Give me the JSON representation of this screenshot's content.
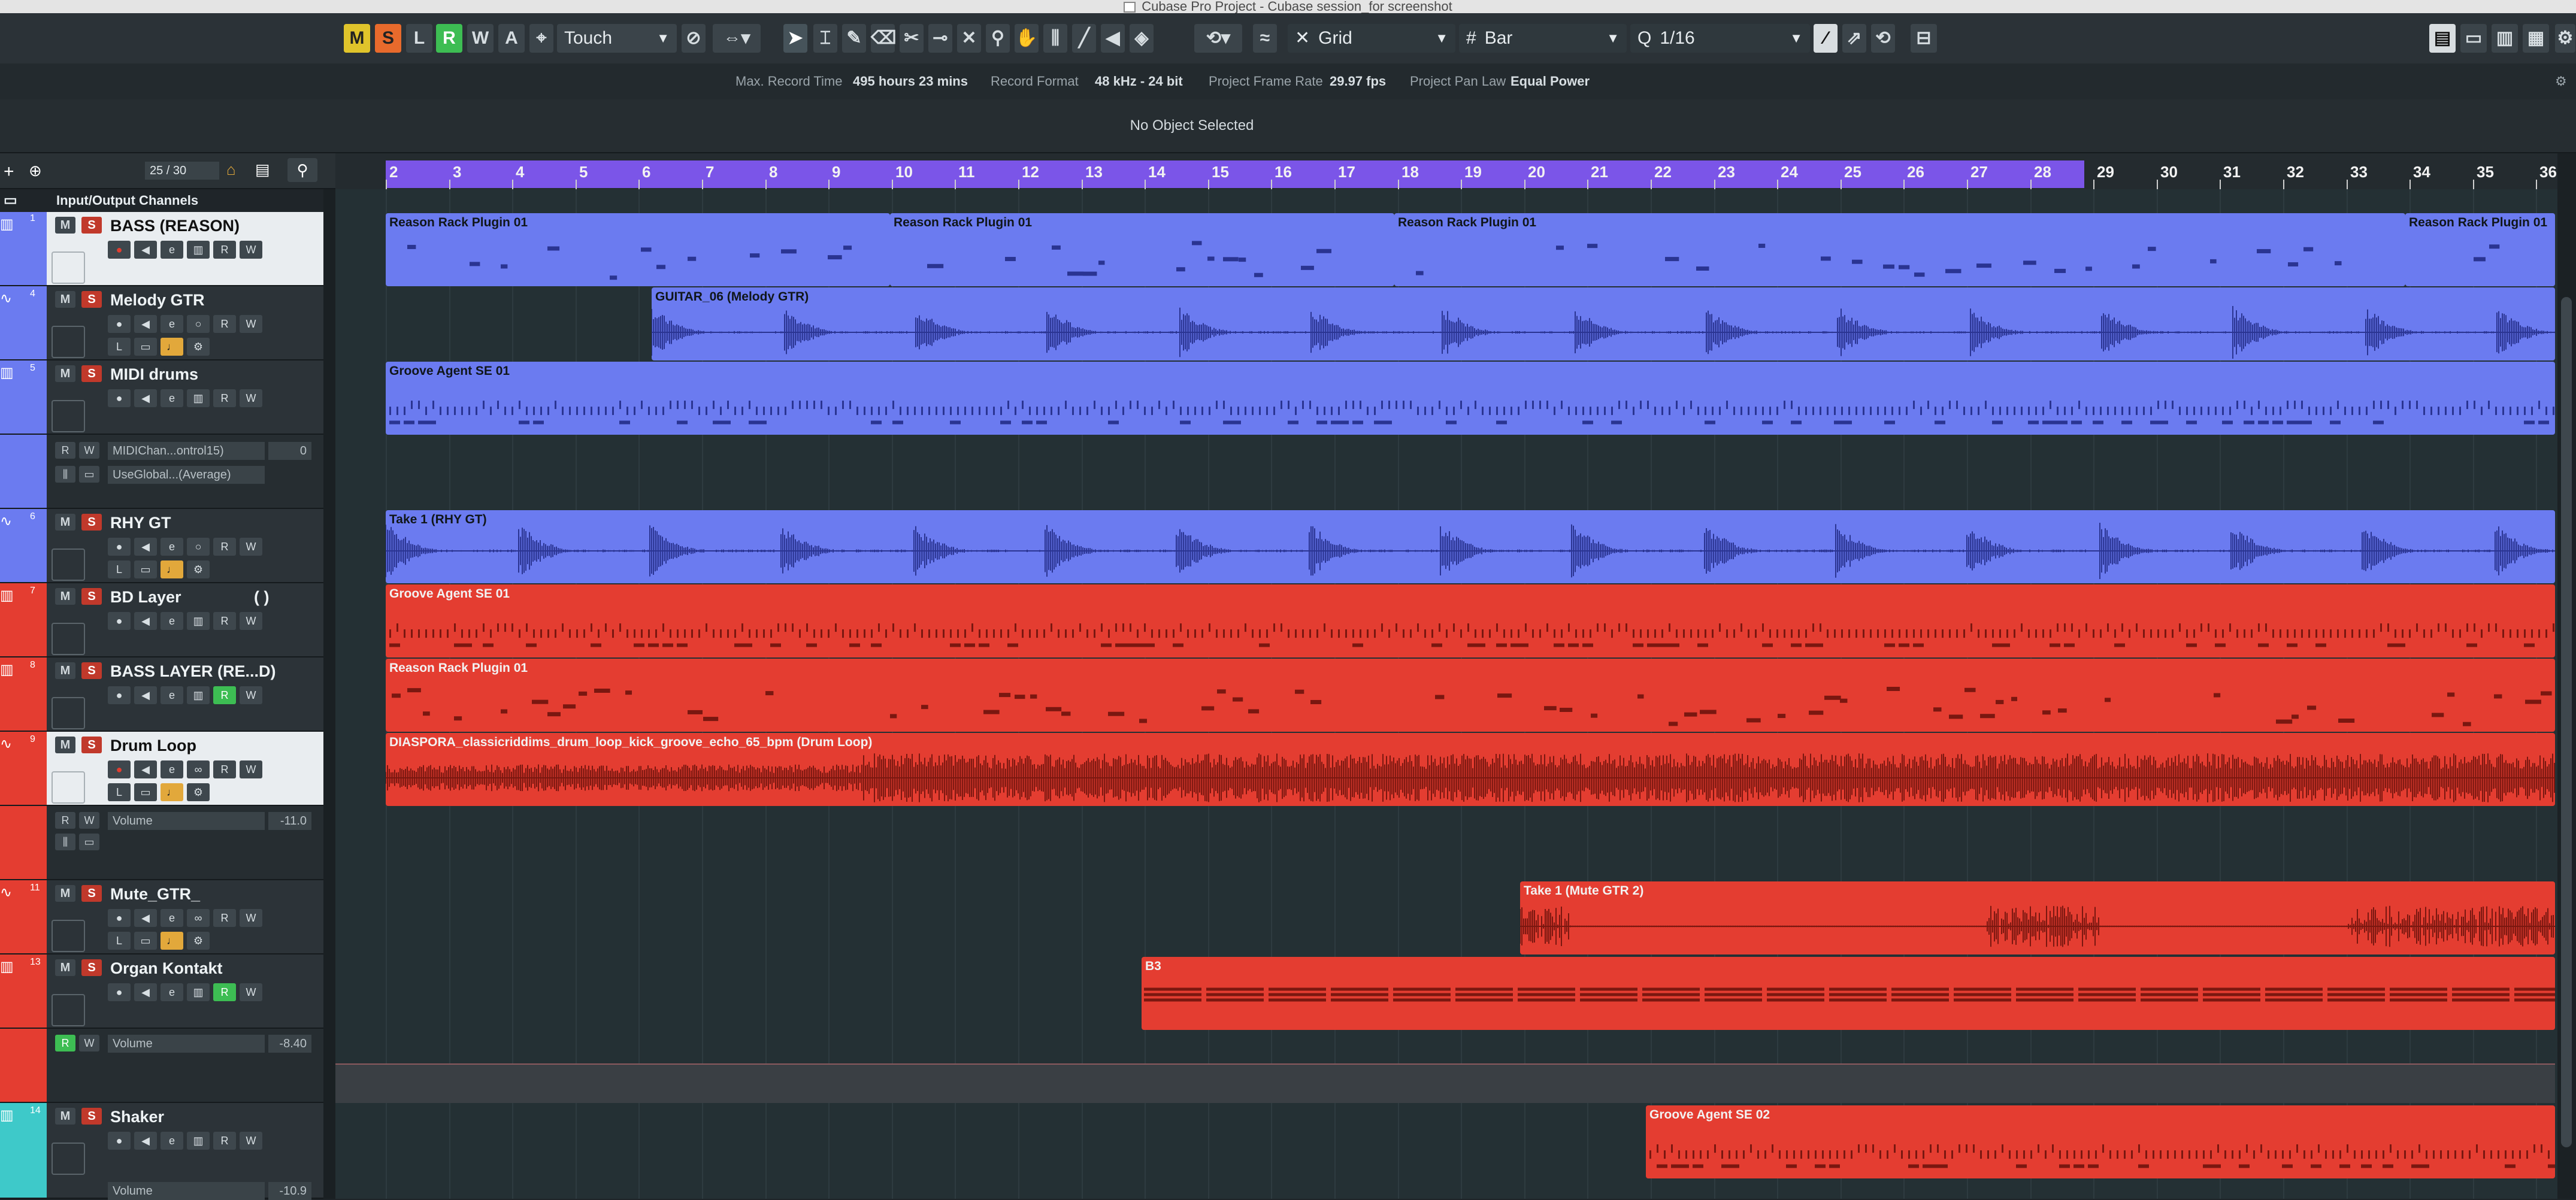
{
  "window": {
    "title": "Cubase Pro Project - Cubase session_for screenshot"
  },
  "toolbar": {
    "mode_buttons": [
      "M",
      "S",
      "L",
      "R",
      "W",
      "A"
    ],
    "automation_mode": "Touch",
    "snap_type": "Grid",
    "grid_type": "Bar",
    "quantize": "1/16"
  },
  "info_line": {
    "max_record_label": "Max. Record Time",
    "max_record_value": "495 hours 23 mins",
    "record_format_label": "Record Format",
    "record_format_value": "48 kHz - 24 bit",
    "frame_rate_label": "Project Frame Rate",
    "frame_rate_value": "29.97 fps",
    "pan_law_label": "Project Pan Law",
    "pan_law_value": "Equal Power"
  },
  "info_bar": {
    "status": "No Object Selected"
  },
  "track_controls": {
    "track_count": "25 / 30"
  },
  "io_channels_label": "Input/Output Channels",
  "ruler": {
    "bars": [
      "2",
      "3",
      "4",
      "5",
      "6",
      "7",
      "8",
      "9",
      "10",
      "11",
      "12",
      "13",
      "14",
      "15",
      "16",
      "17",
      "18",
      "19",
      "20",
      "21",
      "22",
      "23",
      "24",
      "25",
      "26",
      "27",
      "28",
      "29",
      "30",
      "31",
      "32",
      "33",
      "34",
      "35",
      "36"
    ]
  },
  "tracks": [
    {
      "num": "1",
      "name": "BASS (REASON)",
      "color": "#6b7bf0"
    },
    {
      "num": "4",
      "name": "Melody GTR",
      "color": "#6b7bf0"
    },
    {
      "num": "5",
      "name": "MIDI drums",
      "color": "#6b7bf0"
    },
    {
      "num": "6",
      "name": "RHY GT",
      "color": "#6b7bf0"
    },
    {
      "num": "7",
      "name": "BD Layer",
      "extra": "( )",
      "color": "#e43d31"
    },
    {
      "num": "8",
      "name": "BASS LAYER (RE...D)",
      "color": "#e43d31"
    },
    {
      "num": "9",
      "name": "Drum Loop",
      "color": "#e43d31"
    },
    {
      "num": "11",
      "name": "Mute_GTR_",
      "color": "#e43d31"
    },
    {
      "num": "13",
      "name": "Organ Kontakt",
      "color": "#e43d31"
    },
    {
      "num": "14",
      "name": "Shaker",
      "color": "#3ec9c9"
    }
  ],
  "automation": {
    "midi_cc_name": "MIDIChan...ontrol15)",
    "midi_cc_value": "0",
    "midi_global": "UseGlobal...(Average)",
    "drum_volume_label": "Volume",
    "drum_volume_value": "-11.0",
    "organ_volume_label": "Volume",
    "organ_volume_value": "-8.40",
    "shaker_volume_label": "Volume",
    "shaker_volume_value": "-10.9"
  },
  "clips": {
    "bass1": "Reason Rack Plugin 01",
    "bass2": "Reason Rack Plugin 01",
    "bass3": "Reason Rack Plugin 01",
    "bass4": "Reason Rack Plugin 01",
    "melody": "GUITAR_06 (Melody GTR)",
    "midi_drums": "Groove Agent SE 01",
    "rhy": "Take 1 (RHY GT)",
    "bd_layer": "Groove Agent SE 01",
    "bass_layer": "Reason Rack Plugin 01",
    "drum_loop": "DIASPORA_classicriddims_drum_loop_kick_groove_echo_65_bpm (Drum Loop)",
    "mute_gtr": "Take 1 (Mute GTR 2)",
    "organ": "B3",
    "shaker": "Groove Agent SE 02"
  },
  "colors": {
    "blue_track": "#6b7bf0",
    "red_track": "#e43d31",
    "ruler_cycle": "#7b55e8",
    "teal_track": "#3ec9c9"
  }
}
